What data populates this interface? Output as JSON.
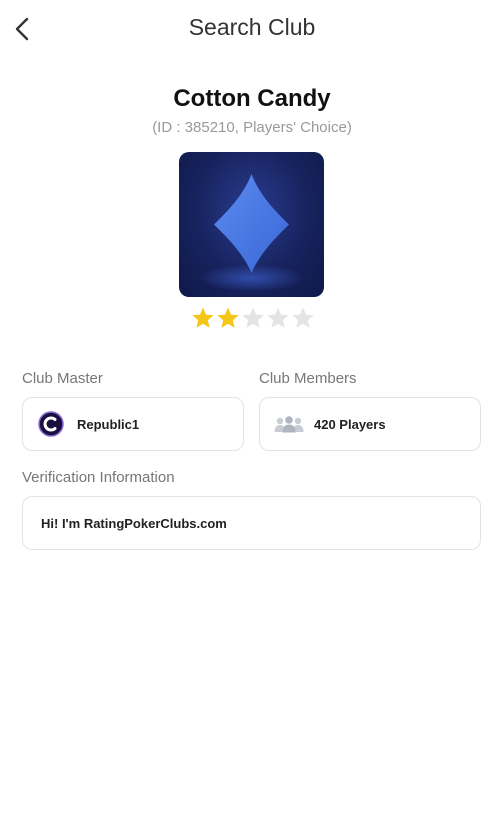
{
  "header": {
    "title": "Search Club",
    "back_icon": "chevron-left-icon"
  },
  "club": {
    "name": "Cotton Candy",
    "subtitle": "(ID : 385210, Players' Choice)",
    "logo_icon": "diamond-suit-icon",
    "rating": 2,
    "rating_max": 5
  },
  "master": {
    "label": "Club Master",
    "name": "Republic1",
    "avatar_icon": "club-avatar-icon"
  },
  "members": {
    "label": "Club Members",
    "value": "420 Players",
    "icon": "users-icon"
  },
  "verification": {
    "label": "Verification Information",
    "text": "Hi! I'm RatingPokerClubs.com"
  },
  "colors": {
    "star_filled": "#f5c518",
    "star_empty": "#e4e4e4",
    "logo_bg": "#17235e",
    "diamond": "#4a7be6"
  }
}
